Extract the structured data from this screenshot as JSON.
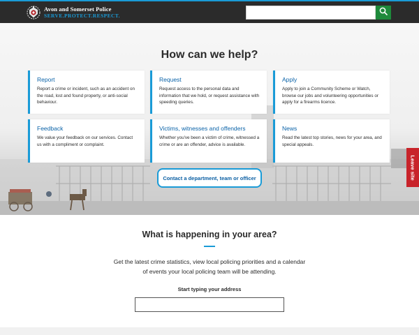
{
  "header": {
    "org_name": "Avon and Somerset Police",
    "motto": "SERVE.PROTECT.RESPECT.",
    "search": {
      "value": "",
      "placeholder": "",
      "icon": "search-icon"
    },
    "accent": "#1a9bd7",
    "search_button_color": "#1e8a3b"
  },
  "help": {
    "heading": "How can we help?",
    "cards": [
      {
        "title": "Report",
        "desc": "Report a crime or incident, such as an accident on the road, lost and found property, or anti-social behaviour."
      },
      {
        "title": "Request",
        "desc": "Request access to the personal data and information that we hold, or request assistance with speeding queries."
      },
      {
        "title": "Apply",
        "desc": "Apply to join a Community Scheme or Watch, browse our jobs and volunteering opportunities or apply for a firearms licence."
      },
      {
        "title": "Feedback",
        "desc": "We value your feedback on our services. Contact us with a compliment or complaint."
      },
      {
        "title": "Victims, witnesses and offenders",
        "desc": "Whether you've been a victim of crime, witnessed a crime or are an offender, advice is available."
      },
      {
        "title": "News",
        "desc": "Read the latest top stories, news for your area, and special appeals."
      }
    ],
    "contact_button": "Contact a department, team or officer"
  },
  "leave_site": {
    "label": "Leave site",
    "color": "#c8232a"
  },
  "area": {
    "heading": "What is happening in your area?",
    "desc": "Get the latest crime statistics, view local policing priorities and a calendar of events your local policing team will be attending.",
    "address_label": "Start typing your address",
    "address_value": "",
    "address_placeholder": ""
  }
}
